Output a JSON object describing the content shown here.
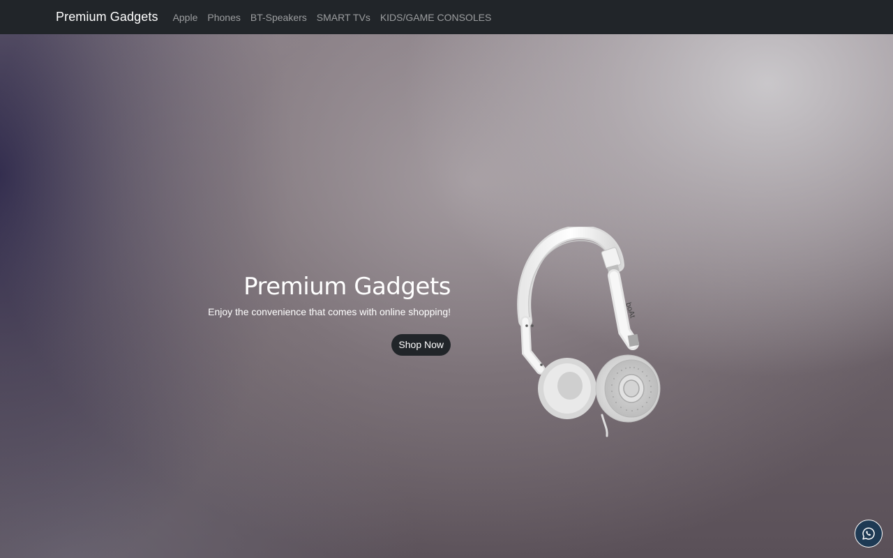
{
  "navbar": {
    "brand": "Premium Gadgets",
    "links": [
      {
        "label": "Apple"
      },
      {
        "label": "Phones"
      },
      {
        "label": "BT-Speakers"
      },
      {
        "label": "SMART TVs"
      },
      {
        "label": "KIDS/GAME CONSOLES"
      }
    ]
  },
  "hero": {
    "title": "Premium Gadgets",
    "subtitle": "Enjoy the convenience that comes with online shopping!",
    "button_label": "Shop Now",
    "image_icon": "headphones-image",
    "headphone_brand_text": "boAt"
  },
  "floating": {
    "whatsapp_icon": "whatsapp-icon"
  },
  "colors": {
    "navbar_bg": "#212529",
    "button_bg": "#212529",
    "whatsapp_bg": "#1e3a54"
  }
}
